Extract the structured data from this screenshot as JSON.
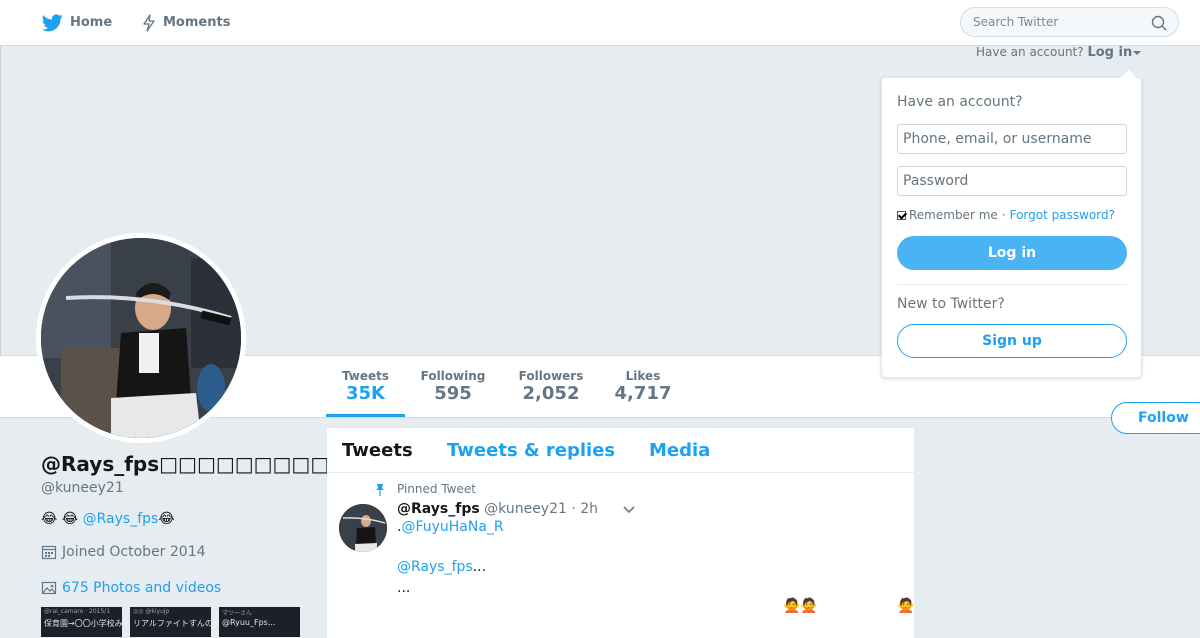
{
  "nav": {
    "home": "Home",
    "moments": "Moments",
    "search_placeholder": "Search Twitter"
  },
  "account_prompt": {
    "text": "Have an account?",
    "login": "Log in"
  },
  "stats": [
    {
      "label": "Tweets",
      "value": "35K"
    },
    {
      "label": "Following",
      "value": "595"
    },
    {
      "label": "Followers",
      "value": "2,052"
    },
    {
      "label": "Likes",
      "value": "4,717"
    }
  ],
  "follow_button": "Follow",
  "profile": {
    "name": "@Rays_fps□□□□□□□□□□",
    "handle": "@kuneey21",
    "bio_emoji": "😂 😂",
    "bio_mention": "@Rays_fps",
    "bio_tail": "😂",
    "joined": "Joined October 2014",
    "photos": "675 Photos and videos"
  },
  "thumbnails": [
    {
      "meta": "@rai_camaro · 2015/1",
      "text": "保育園→〇〇小学校みた"
    },
    {
      "meta": "◎◎ @kiyujp",
      "text": "リアルファイトすんの？笑"
    },
    {
      "meta": "マツーさん",
      "text": "@Ryuu_Fps..."
    }
  ],
  "timeline": {
    "tabs": [
      "Tweets",
      "Tweets & replies",
      "Media"
    ],
    "pinned_label": "Pinned Tweet",
    "tweet": {
      "name": "@Rays_fps",
      "handle": "@kuneey21",
      "time": "· 2h",
      "line1_prefix": ".",
      "line1_mention": "@FuyuHaNa_R",
      "line2_mention": "@Rays_fps",
      "line2_tail": "...",
      "line3": "...",
      "emoji_a": "🙅🙅",
      "emoji_b": "🙅"
    }
  },
  "login_dropdown": {
    "title": "Have an account?",
    "username_placeholder": "Phone, email, or username",
    "password_placeholder": "Password",
    "remember": "Remember me",
    "separator": "·",
    "forgot": "Forgot password?",
    "login_button": "Log in",
    "new_to": "New to Twitter?",
    "signup_button": "Sign up"
  },
  "colors": {
    "accent": "#1da1f2",
    "background": "#e6ecf0",
    "muted_text": "#657786"
  }
}
